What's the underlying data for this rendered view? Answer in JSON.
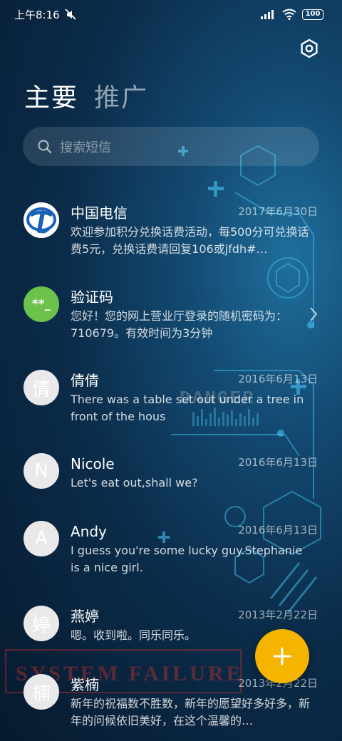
{
  "status_bar": {
    "time": "上午8:16",
    "battery": "100"
  },
  "tabs": [
    {
      "label": "主要",
      "active": true
    },
    {
      "label": "推广",
      "active": false
    }
  ],
  "search": {
    "placeholder": "搜索短信"
  },
  "conversations": [
    {
      "name": "中国电信",
      "date": "2017年6月30日",
      "preview": "欢迎参加积分兑换话费活动，每500分可兑换话费5元，兑换话费请回复106或jfdh#…",
      "avatar_type": "logo"
    },
    {
      "name": "验证码",
      "date": "",
      "preview": "您好！您的网上营业厅登录的随机密码为：710679。有效时间为3分钟",
      "avatar_type": "code",
      "avatar_text": "**_"
    },
    {
      "name": "倩倩",
      "date": "2016年6月13日",
      "preview": "There was a table set out under a tree in front of the hous",
      "avatar_type": "letter",
      "avatar_text": "倩"
    },
    {
      "name": "Nicole",
      "date": "2016年6月13日",
      "preview": "Let's eat out,shall we?",
      "avatar_type": "letter",
      "avatar_text": "N"
    },
    {
      "name": "Andy",
      "date": "2016年6月13日",
      "preview": "I guess you're some lucky guy.Stephanie is a nice girl.",
      "avatar_type": "letter",
      "avatar_text": "A"
    },
    {
      "name": "燕婷",
      "date": "2013年2月22日",
      "preview": "嗯。收到啦。同乐同乐。",
      "avatar_type": "letter",
      "avatar_text": "婷"
    },
    {
      "name": "紫楠",
      "date": "2013年2月22日",
      "preview": "新年的祝福数不胜数，新年的愿望好多好多，新年的问候依旧美好，在这个温馨的…",
      "avatar_type": "letter",
      "avatar_text": "楠"
    }
  ],
  "wallpaper_text": {
    "danger": "DANGER",
    "system_failure": "SYSTEM FAILURE"
  },
  "colors": {
    "fab": "#f5b400",
    "code_avatar": "#6cc24a",
    "telecom_blue": "#1a62b8"
  },
  "icons": {
    "settings": "hexagon-gear-icon",
    "search": "search-icon",
    "compose": "plus-icon"
  }
}
